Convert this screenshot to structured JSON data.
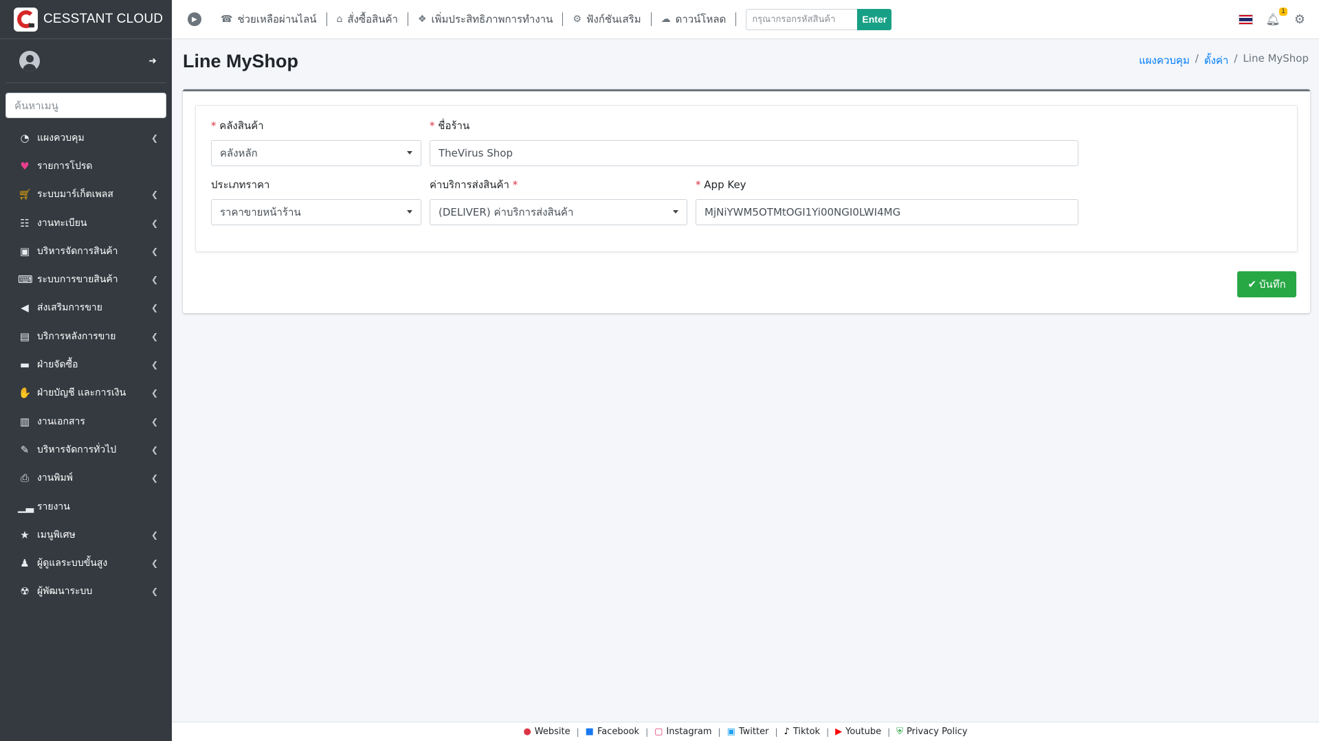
{
  "brand": {
    "name": "CESSTANT CLOUD"
  },
  "sidebar": {
    "search_placeholder": "ค้นหาเมนู",
    "items": [
      {
        "label": "แผงควบคุม",
        "icon": "tachometer-icon",
        "has_children": true
      },
      {
        "label": "รายการโปรด",
        "icon": "heart-icon",
        "has_children": false
      },
      {
        "label": "ระบบมาร์เก็ตเพลส",
        "icon": "cart-icon",
        "has_children": true
      },
      {
        "label": "งานทะเบียน",
        "icon": "document-icon",
        "has_children": true
      },
      {
        "label": "บริหารจัดการสินค้า",
        "icon": "box-icon",
        "has_children": true
      },
      {
        "label": "ระบบการขายสินค้า",
        "icon": "cash-register-icon",
        "has_children": true
      },
      {
        "label": "ส่งเสริมการขาย",
        "icon": "bullhorn-icon",
        "has_children": true
      },
      {
        "label": "บริการหลังการขาย",
        "icon": "toolbox-icon",
        "has_children": true
      },
      {
        "label": "ฝ่ายจัดซื้อ",
        "icon": "wallet-icon",
        "has_children": true
      },
      {
        "label": "ฝ่ายบัญชี และการเงิน",
        "icon": "hand-money-icon",
        "has_children": true
      },
      {
        "label": "งานเอกสาร",
        "icon": "book-icon",
        "has_children": true
      },
      {
        "label": "บริหารจัดการทั่วไป",
        "icon": "pen-icon",
        "has_children": true
      },
      {
        "label": "งานพิมพ์",
        "icon": "printer-icon",
        "has_children": true
      },
      {
        "label": "รายงาน",
        "icon": "chart-bar-icon",
        "has_children": false
      },
      {
        "label": "เมนูพิเศษ",
        "icon": "star-icon",
        "has_children": true
      },
      {
        "label": "ผู้ดูแลระบบขั้นสูง",
        "icon": "user-secret-icon",
        "has_children": true
      },
      {
        "label": "ผู้พัฒนาระบบ",
        "icon": "radiation-icon",
        "has_children": true
      }
    ]
  },
  "topbar": {
    "nav": [
      {
        "label": "ช่วยเหลือผ่านไลน์",
        "icon": "phone-icon"
      },
      {
        "label": "สั่งซื้อสินค้า",
        "icon": "basket-icon"
      },
      {
        "label": "เพิ่มประสิทธิภาพการทำงาน",
        "icon": "puzzle-icon"
      },
      {
        "label": "ฟังก์ชันเสริม",
        "icon": "cog-icon"
      },
      {
        "label": "ดาวน์โหลด",
        "icon": "cloud-download-icon"
      }
    ],
    "search_placeholder": "กรุณากรอกรหัสสินค้า",
    "enter_label": "Enter",
    "notification_count": "1"
  },
  "page": {
    "title": "Line MyShop",
    "breadcrumb": [
      "แผงควบคุม",
      "ตั้งค่า",
      "Line MyShop"
    ]
  },
  "form": {
    "warehouse": {
      "label": "คลังสินค้า",
      "value": "คลังหลัก",
      "required": true
    },
    "shop_name": {
      "label": "ชื่อร้าน",
      "value": "TheVirus Shop",
      "required": true
    },
    "price_type": {
      "label": "ประเภทราคา",
      "value": "ราคาขายหน้าร้าน",
      "required": false
    },
    "shipping": {
      "label": "ค่าบริการส่งสินค้า",
      "value": "(DELIVER) ค่าบริการส่งสินค้า",
      "required": true
    },
    "app_key": {
      "label": "App Key",
      "value": "MjNiYWM5OTMtOGI1Yi00NGI0LWI4MG",
      "required": true
    },
    "save_label": "บันทึก"
  },
  "footer": {
    "links": [
      {
        "label": "Website",
        "icon": "globe-icon",
        "color": "#dc3545"
      },
      {
        "label": "Facebook",
        "icon": "facebook-icon",
        "color": "#1877f2"
      },
      {
        "label": "Instagram",
        "icon": "instagram-icon",
        "color": "#e1306c"
      },
      {
        "label": "Twitter",
        "icon": "twitter-icon",
        "color": "#1da1f2"
      },
      {
        "label": "Tiktok",
        "icon": "tiktok-icon",
        "color": "#000000"
      },
      {
        "label": "Youtube",
        "icon": "youtube-icon",
        "color": "#ff0000"
      },
      {
        "label": "Privacy Policy",
        "icon": "shield-icon",
        "color": "#28a745"
      }
    ]
  },
  "colors": {
    "sidebar_bg": "#343a40",
    "save_green": "#28a745",
    "enter_teal": "#17a085",
    "link_blue": "#007bff",
    "required_red": "#dc3545"
  }
}
